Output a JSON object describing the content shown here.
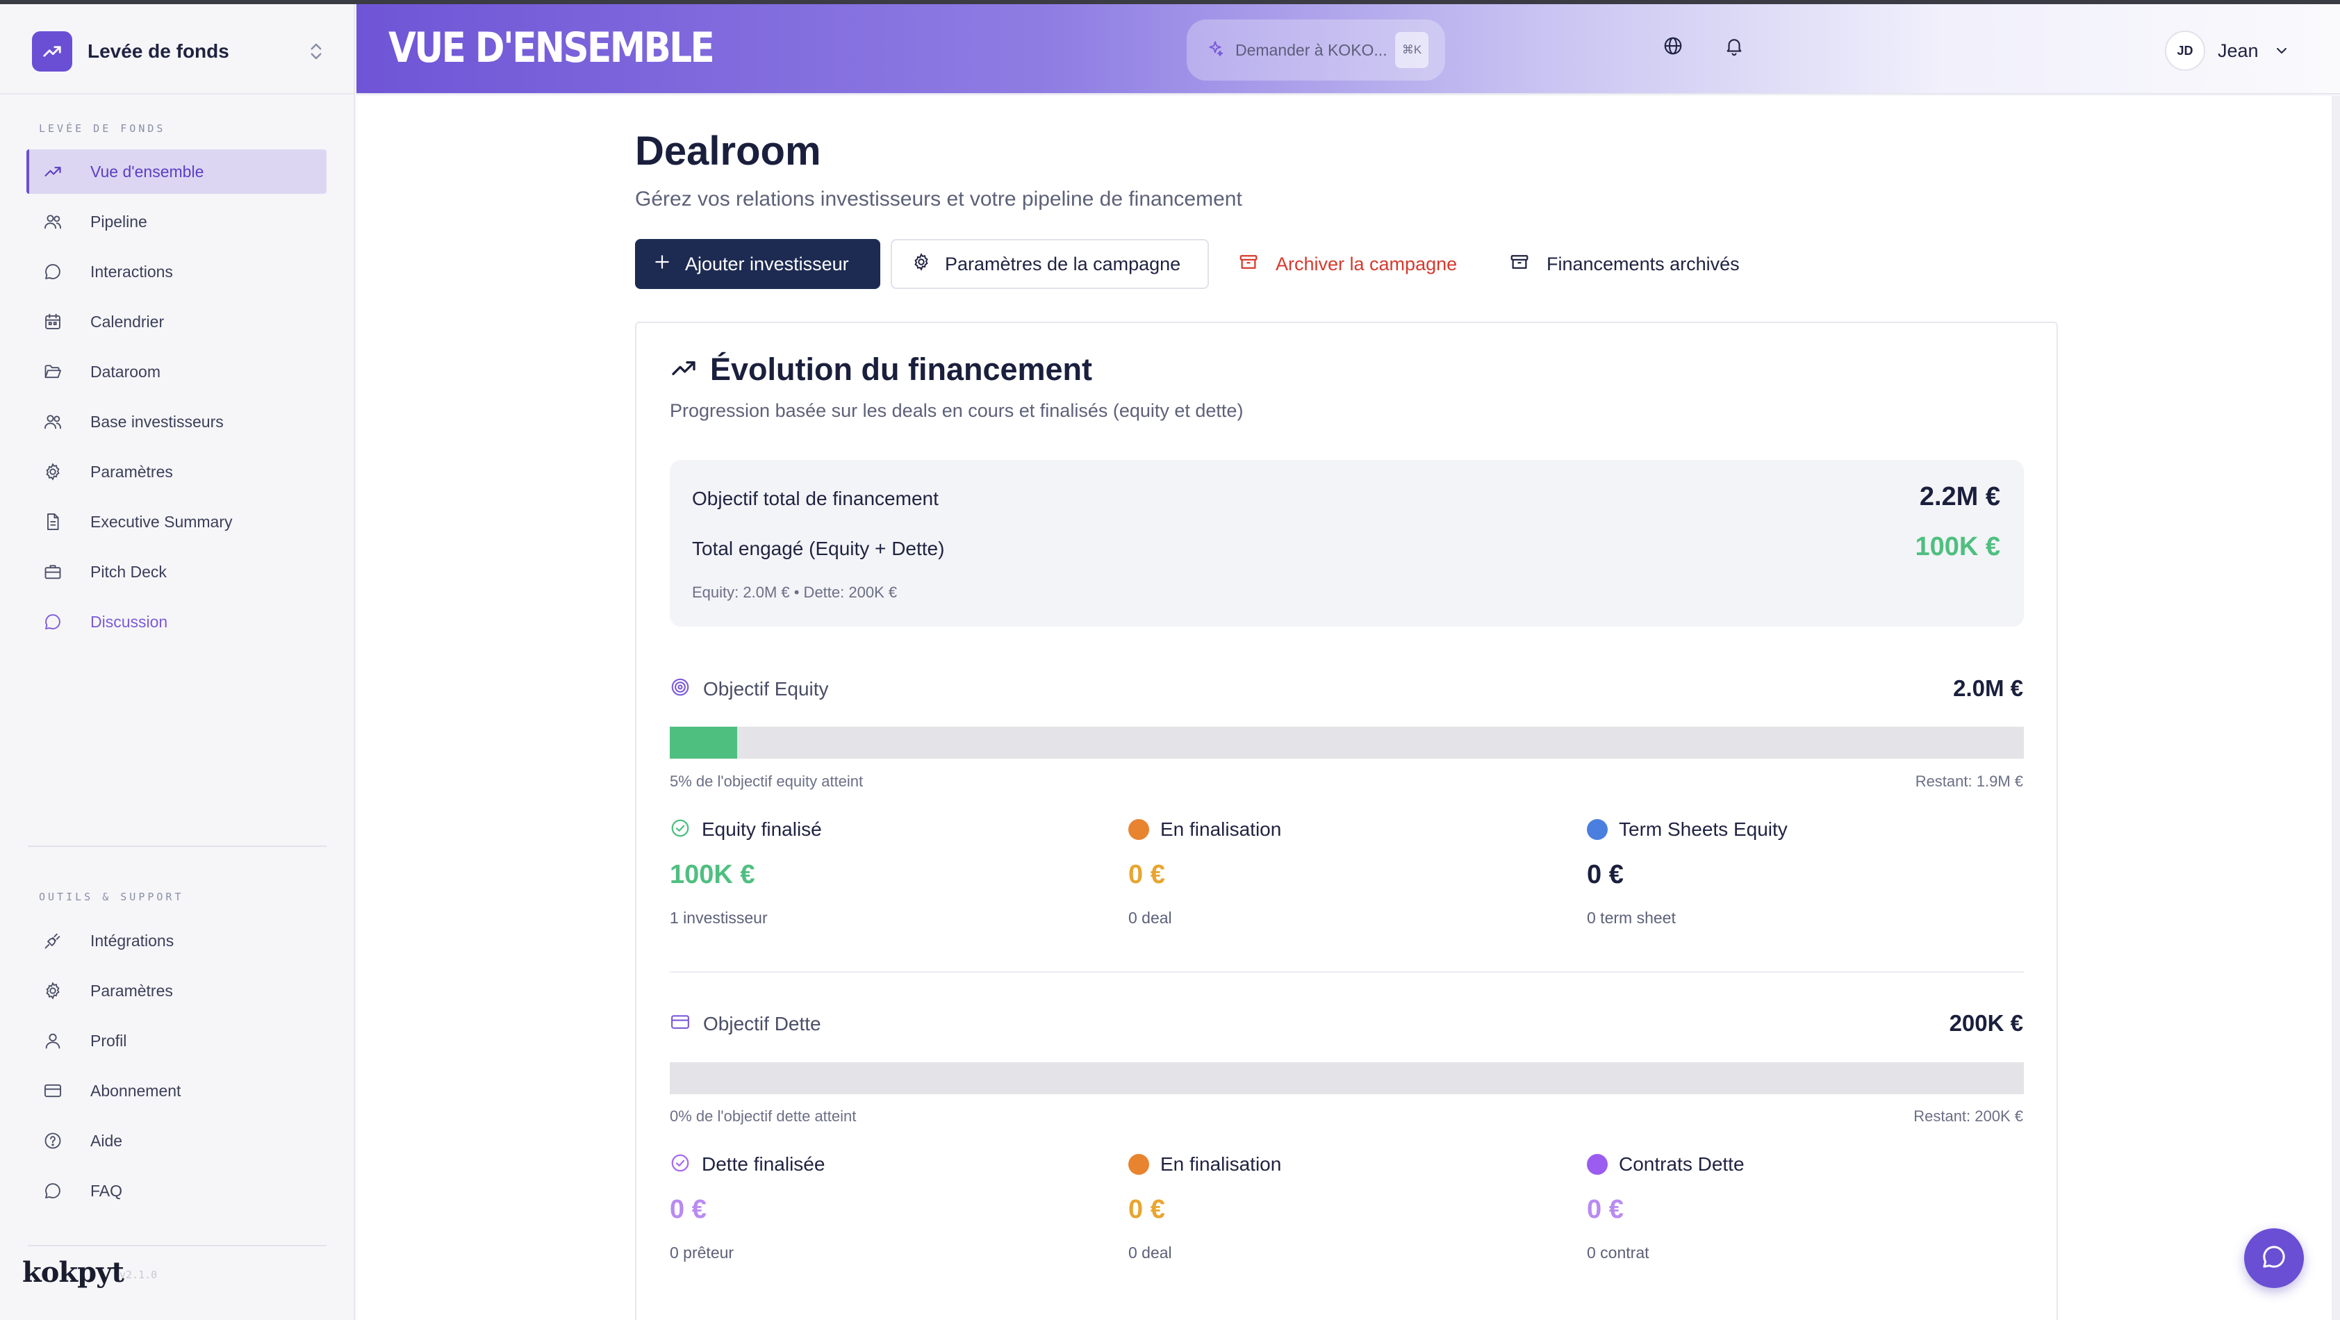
{
  "workspace": {
    "name": "Levée de fonds"
  },
  "sidebar": {
    "section_main": "LEVÉE DE FONDS",
    "items": [
      {
        "label": "Vue d'ensemble",
        "icon": "trending-up-icon"
      },
      {
        "label": "Pipeline",
        "icon": "users-icon"
      },
      {
        "label": "Interactions",
        "icon": "chat-bubble-icon"
      },
      {
        "label": "Calendrier",
        "icon": "calendar-icon"
      },
      {
        "label": "Dataroom",
        "icon": "folder-open-icon"
      },
      {
        "label": "Base investisseurs",
        "icon": "users-icon"
      },
      {
        "label": "Paramètres",
        "icon": "gear-icon"
      },
      {
        "label": "Executive Summary",
        "icon": "document-icon"
      },
      {
        "label": "Pitch Deck",
        "icon": "briefcase-icon"
      },
      {
        "label": "Discussion",
        "icon": "chat-bubble-icon"
      }
    ],
    "section_tools": "OUTILS & SUPPORT",
    "tools": [
      {
        "label": "Intégrations",
        "icon": "plug-icon"
      },
      {
        "label": "Paramètres",
        "icon": "gear-icon"
      },
      {
        "label": "Profil",
        "icon": "user-icon"
      },
      {
        "label": "Abonnement",
        "icon": "credit-card-icon"
      },
      {
        "label": "Aide",
        "icon": "help-circle-icon"
      },
      {
        "label": "FAQ",
        "icon": "chat-bubble-icon"
      }
    ],
    "brand": "kokpyt",
    "version": "v2.1.0"
  },
  "header": {
    "page_heading": "VUE D'ENSEMBLE",
    "ask_placeholder": "Demander à KOKO...",
    "ask_shortcut": "⌘K",
    "user_initials": "JD",
    "user_name": "Jean"
  },
  "page": {
    "title": "Dealroom",
    "subtitle": "Gérez vos relations investisseurs et votre pipeline de financement",
    "actions": {
      "add": "Ajouter investisseur",
      "settings": "Paramètres de la campagne",
      "archive": "Archiver la campagne",
      "archived": "Financements archivés"
    }
  },
  "funding": {
    "title": "Évolution du financement",
    "subtitle": "Progression basée sur les deals en cours et finalisés (equity et dette)",
    "summary": {
      "target_label": "Objectif total de financement",
      "target_value": "2.2M €",
      "committed_label": "Total engagé (Equity + Dette)",
      "committed_value": "100K €",
      "note": "Equity: 2.0M € • Dette: 200K €"
    },
    "equity": {
      "label": "Objectif Equity",
      "amount": "2.0M €",
      "progress_percent": 5,
      "caption": "5% de l'objectif equity atteint",
      "remaining": "Restant: 1.9M €",
      "stats": [
        {
          "label": "Equity finalisé",
          "value": "100K €",
          "sub": "1 investisseur",
          "color": "#4fbf80"
        },
        {
          "label": "En finalisation",
          "value": "0 €",
          "sub": "0 deal",
          "color": "#e8832f"
        },
        {
          "label": "Term Sheets Equity",
          "value": "0 €",
          "sub": "0 term sheet",
          "color": "#4a7fe0"
        }
      ]
    },
    "debt": {
      "label": "Objectif Dette",
      "amount": "200K €",
      "progress_percent": 0,
      "caption": "0% de l'objectif dette atteint",
      "remaining": "Restant: 200K €",
      "stats": [
        {
          "label": "Dette finalisée",
          "value": "0 €",
          "sub": "0 prêteur",
          "color": "#a66bf0"
        },
        {
          "label": "En finalisation",
          "value": "0 €",
          "sub": "0 deal",
          "color": "#e8832f"
        },
        {
          "label": "Contrats Dette",
          "value": "0 €",
          "sub": "0 contrat",
          "color": "#9b5cf0"
        }
      ]
    }
  },
  "colors": {
    "accent": "#6a4fd4",
    "primary_button": "#1d2b52",
    "positive": "#4fbf80",
    "danger": "#d53a2f",
    "pending": "#e8832f",
    "debt": "#a66bf0"
  }
}
